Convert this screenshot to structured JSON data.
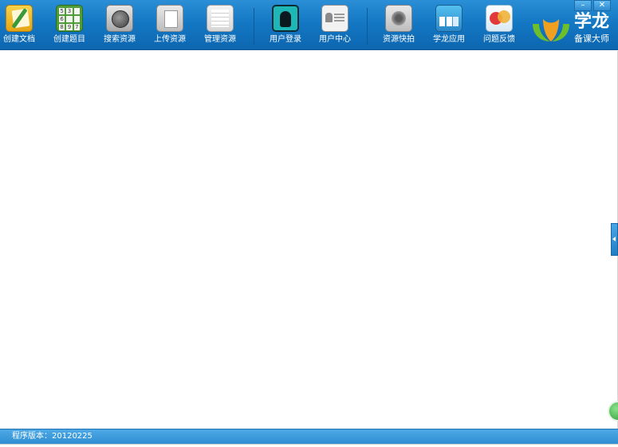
{
  "toolbar": {
    "items": [
      {
        "label": "创建文档",
        "icon": "document-pencil-icon"
      },
      {
        "label": "创建题目",
        "icon": "number-grid-icon"
      },
      {
        "label": "搜索资源",
        "icon": "search-lens-icon"
      },
      {
        "label": "上传资源",
        "icon": "upload-file-icon"
      },
      {
        "label": "管理资源",
        "icon": "manage-list-icon"
      },
      {
        "label": "用户登录",
        "icon": "user-silhouette-icon"
      },
      {
        "label": "用户中心",
        "icon": "user-card-icon"
      },
      {
        "label": "资源快拍",
        "icon": "camera-lens-icon"
      },
      {
        "label": "学龙应用",
        "icon": "app-window-icon"
      },
      {
        "label": "问题反馈",
        "icon": "feedback-bubble-icon"
      }
    ],
    "grid_digits": [
      "5",
      "3",
      "",
      "6",
      "",
      "",
      "8",
      "9",
      "7"
    ]
  },
  "logo": {
    "title": "学龙",
    "subtitle": "备课大师"
  },
  "window_controls": {
    "minimize": "–",
    "close": "✕"
  },
  "status": {
    "version_label": "程序版本：",
    "version": "20120225"
  },
  "colors": {
    "toolbar": "#1478c4",
    "statusbar": "#3a98d9",
    "logo_green": "#6cbf2a",
    "logo_orange": "#f0a020"
  }
}
